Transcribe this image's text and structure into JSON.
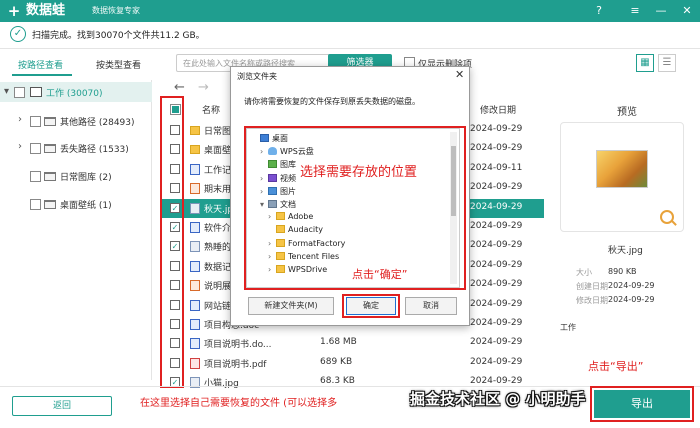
{
  "app": {
    "name": "数据蛙",
    "subtitle": "数据恢复专家",
    "logo_glyph": "+",
    "help_glyph": "?",
    "menu_glyph": "≡",
    "minimize_glyph": "—",
    "close_glyph": "✕"
  },
  "status": {
    "check_glyph": "✓",
    "text": "扫描完成。找到30070个文件共11.2 GB。"
  },
  "tabs": {
    "by_path": "按路径查看",
    "by_type": "按类型查看"
  },
  "toolbar": {
    "search_placeholder": "在此处输入文件名称或路径搜索",
    "filter_label": "筛选器",
    "only_deleted_label": "仅显示删除项",
    "grid_glyph": "▦",
    "list_glyph": "☰",
    "back_glyph": "←",
    "forward_glyph": "→"
  },
  "tree": {
    "root": {
      "label": "工作 (30070)",
      "toggle": "▾"
    },
    "items": [
      {
        "label": "其他路径 (28493)",
        "toggle": "›"
      },
      {
        "label": "丢失路径 (1533)",
        "toggle": "›"
      },
      {
        "label": "日常图库 (2)"
      },
      {
        "label": "桌面壁纸 (1)"
      }
    ]
  },
  "file_list": {
    "header": {
      "name": "名称",
      "date": "修改日期"
    },
    "check_glyph": "✓",
    "rows": [
      {
        "name": "日常图库",
        "size": "",
        "date": "2024-09-29",
        "icon": "folder",
        "checked": false,
        "selected": false
      },
      {
        "name": "桌面壁纸",
        "size": "",
        "date": "2024-09-29",
        "icon": "folder",
        "checked": false,
        "selected": false
      },
      {
        "name": "工作记录1",
        "size": "",
        "date": "2024-09-11",
        "icon": "doc",
        "checked": false,
        "selected": false
      },
      {
        "name": "期末用.ppt",
        "size": "",
        "date": "2024-09-29",
        "icon": "ppt",
        "checked": false,
        "selected": false
      },
      {
        "name": "秋天.jpg",
        "size": "",
        "date": "2024-09-29",
        "icon": "img",
        "checked": true,
        "selected": true
      },
      {
        "name": "软件介绍 -",
        "size": "",
        "date": "2024-09-29",
        "icon": "doc",
        "checked": true,
        "selected": false
      },
      {
        "name": "熟睡的小猫",
        "size": "",
        "date": "2024-09-29",
        "icon": "img",
        "checked": true,
        "selected": false
      },
      {
        "name": "数据记录表",
        "size": "",
        "date": "2024-09-29",
        "icon": "doc",
        "checked": false,
        "selected": false
      },
      {
        "name": "说明展示.p",
        "size": "",
        "date": "2024-09-29",
        "icon": "ppt",
        "checked": false,
        "selected": false
      },
      {
        "name": "网站链接.t",
        "size": "",
        "date": "2024-09-29",
        "icon": "doc",
        "checked": false,
        "selected": false
      },
      {
        "name": "项目构思.doc",
        "size": "",
        "date": "2024-09-29",
        "icon": "doc",
        "checked": false,
        "selected": false
      },
      {
        "name": "项目说明书.do...",
        "size": "1.68 MB",
        "date": "2024-09-29",
        "icon": "doc",
        "checked": false,
        "selected": false
      },
      {
        "name": "项目说明书.pdf",
        "size": "689 KB",
        "date": "2024-09-29",
        "icon": "pdf",
        "checked": false,
        "selected": false
      },
      {
        "name": "小猫.jpg",
        "size": "68.3 KB",
        "date": "2024-09-29",
        "icon": "img",
        "checked": true,
        "selected": false
      }
    ]
  },
  "preview": {
    "title": "预览",
    "file_name": "秋天.jpg",
    "meta": [
      {
        "key": "大小",
        "value": "890 KB"
      },
      {
        "key": "创建日期",
        "value": "2024-09-29"
      },
      {
        "key": "修改日期",
        "value": "2024-09-29"
      }
    ],
    "path_label": "工作"
  },
  "dialog": {
    "title": "浏览文件夹",
    "close_glyph": "✕",
    "instruction": "请你将需要恢复的文件保存到原丢失数据的磁盘。",
    "nodes": [
      {
        "label": "桌面",
        "icon": "desktop",
        "indent": 0,
        "toggle": ""
      },
      {
        "label": "WPS云盘",
        "icon": "cloud",
        "indent": 1,
        "toggle": "›"
      },
      {
        "label": "图库",
        "icon": "gallery",
        "indent": 1,
        "toggle": ""
      },
      {
        "label": "视频",
        "icon": "video",
        "indent": 1,
        "toggle": "›"
      },
      {
        "label": "图片",
        "icon": "image",
        "indent": 1,
        "toggle": "›"
      },
      {
        "label": "文档",
        "icon": "doc",
        "indent": 1,
        "toggle": "▾"
      },
      {
        "label": "Adobe",
        "icon": "folder",
        "indent": 2,
        "toggle": "›"
      },
      {
        "label": "Audacity",
        "icon": "folder",
        "indent": 2,
        "toggle": ""
      },
      {
        "label": "FormatFactory",
        "icon": "folder",
        "indent": 2,
        "toggle": "›"
      },
      {
        "label": "Tencent Files",
        "icon": "folder",
        "indent": 2,
        "toggle": "›"
      },
      {
        "label": "WPSDrive",
        "icon": "folder",
        "indent": 2,
        "toggle": "›"
      }
    ],
    "new_folder_label": "新建文件夹(M)",
    "ok_label": "确定",
    "cancel_label": "取消"
  },
  "annotations": {
    "select_location": "选择需要存放的位置",
    "click_ok": "点击“确定”",
    "bottom_hint": "在这里选择自己需要恢复的文件 (可以选择多",
    "click_export": "点击“导出”"
  },
  "watermark": "掘金技术社区 @ 小明助手",
  "footer": {
    "back_label": "返回",
    "export_label": "导出"
  },
  "colors": {
    "accent": "#1f9e8f",
    "annotation_red": "#e02020"
  }
}
